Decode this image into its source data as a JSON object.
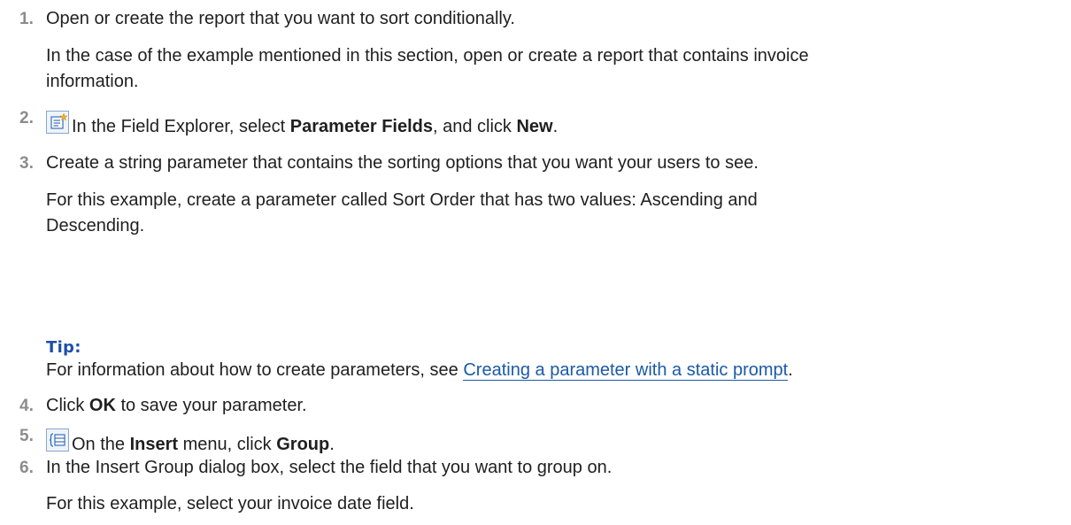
{
  "steps": [
    {
      "num": "1.",
      "text": "Open or create the report that you want to sort conditionally.",
      "note": [
        "In the case of the example mentioned in this section, open or create a report that contains invoice",
        "information."
      ]
    },
    {
      "num": "2.",
      "icon": "field-explorer-new-icon",
      "pre": "In the Field Explorer, select ",
      "bold1": "Parameter Fields",
      "mid": ", and click ",
      "bold2": "New",
      "post": "."
    },
    {
      "num": "3.",
      "text": "Create a string parameter that contains the sorting options that you want your users to see.",
      "note": [
        "For this example, create a parameter called Sort Order that has two values: Ascending and",
        "Descending."
      ]
    },
    {
      "num": "4.",
      "pre": "Click ",
      "bold1": "OK",
      "post": " to save your parameter."
    },
    {
      "num": "5.",
      "icon": "insert-group-icon",
      "pre": "On the ",
      "bold1": "Insert",
      "mid": " menu, click ",
      "bold2": "Group",
      "post": "."
    },
    {
      "num": "6.",
      "text": "In the Insert Group dialog box, select the field that you want to group on.",
      "note": [
        "For this example, select your invoice date field."
      ]
    }
  ],
  "tip": {
    "label": "Tip:",
    "pre": "For information about how to create parameters, see ",
    "link": "Creating a parameter with a static prompt",
    "post": "."
  }
}
